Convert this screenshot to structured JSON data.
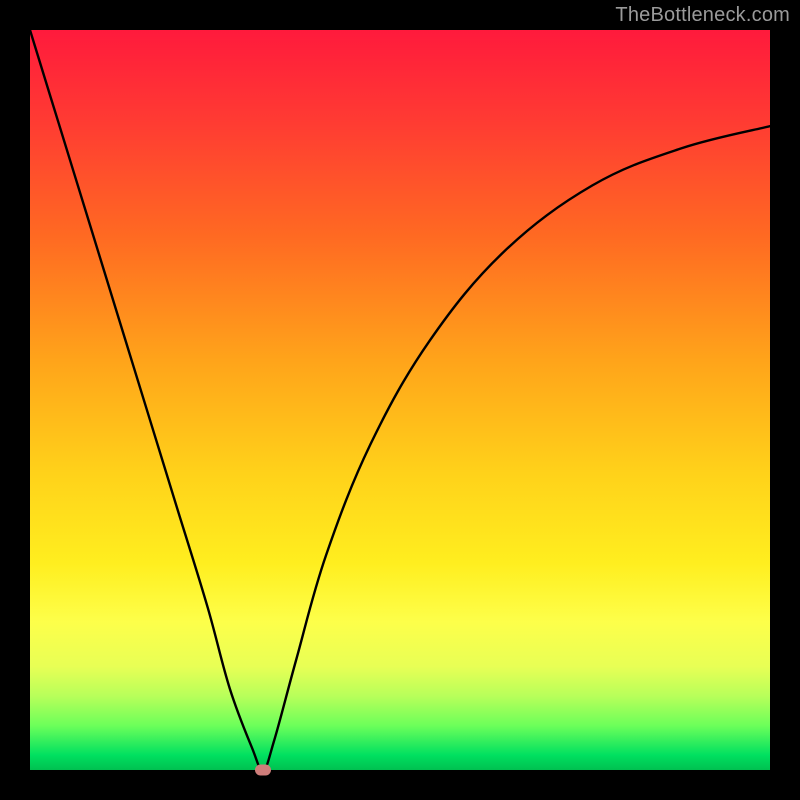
{
  "watermark": "TheBottleneck.com",
  "chart_data": {
    "type": "line",
    "title": "",
    "xlabel": "",
    "ylabel": "",
    "xlim": [
      0,
      100
    ],
    "ylim": [
      0,
      100
    ],
    "background_gradient": {
      "top": "#ff1a3c",
      "upper_mid": "#ffa51a",
      "mid": "#ffee1f",
      "lower_mid": "#b8ff5a",
      "bottom": "#00c050"
    },
    "series": [
      {
        "name": "curve",
        "color": "#000000",
        "x": [
          0,
          4,
          8,
          12,
          16,
          20,
          24,
          27,
          30,
          31.5,
          33,
          36,
          40,
          46,
          54,
          64,
          76,
          88,
          100
        ],
        "y": [
          100,
          87,
          74,
          61,
          48,
          35,
          22,
          11,
          3,
          0,
          4,
          15,
          29,
          44,
          58,
          70,
          79,
          84,
          87
        ]
      }
    ],
    "marker": {
      "x": 31.5,
      "y": 0,
      "color": "#cf7d7a"
    }
  }
}
